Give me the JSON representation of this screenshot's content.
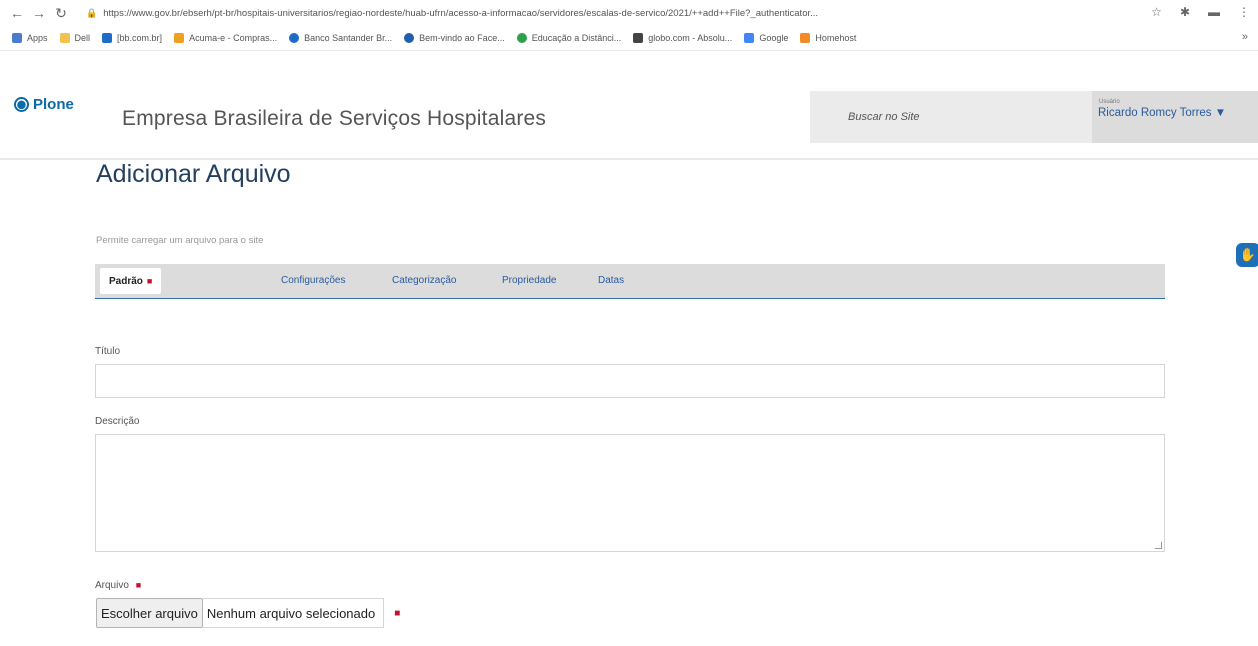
{
  "browser": {
    "url": "https://www.gov.br/ebserh/pt-br/hospitais-universitarios/regiao-nordeste/huab-ufrn/acesso-a-informacao/servidores/escalas-de-servico/2021/++add++File?_authenticator...",
    "bookmarks": [
      {
        "label": "Apps",
        "icon": "apps-grid-icon",
        "color": "#4a7bd0"
      },
      {
        "label": "Dell",
        "icon": "folder-icon",
        "color": "#f2c14e"
      },
      {
        "label": "[bb.com.br]",
        "icon": "bb-icon",
        "color": "#1e6cc8"
      },
      {
        "label": "Acuma-e - Compras...",
        "icon": "store-icon",
        "color": "#f0a020"
      },
      {
        "label": "Banco Santander Br...",
        "icon": "santander-icon",
        "color": "#1e6cc8"
      },
      {
        "label": "Bem-vindo ao Face...",
        "icon": "facebook-icon",
        "color": "#1f5fb0"
      },
      {
        "label": "Educação a Distânci...",
        "icon": "education-icon",
        "color": "#2ea04a"
      },
      {
        "label": "globo.com - Absolu...",
        "icon": "globo-icon",
        "color": "#444444"
      },
      {
        "label": "Google",
        "icon": "google-icon",
        "color": "#4285f4"
      },
      {
        "label": "Homehost",
        "icon": "homehost-icon",
        "color": "#f28c28"
      }
    ]
  },
  "header": {
    "logo_text": "Plone",
    "site_title": "Empresa Brasileira de Serviços Hospitalares",
    "search_placeholder": "Buscar no Site",
    "user_label": "Usuário",
    "user_name": "Ricardo Romcy Torres ▼"
  },
  "page": {
    "title": "Adicionar Arquivo",
    "description": "Permite carregar um arquivo para o site",
    "tabs": [
      {
        "label": "Padrão",
        "active": true
      },
      {
        "label": "Configurações"
      },
      {
        "label": "Categorização"
      },
      {
        "label": "Propriedade"
      },
      {
        "label": "Datas"
      }
    ],
    "required_mark": "■",
    "fields": {
      "title_label": "Título",
      "title_value": "",
      "description_label": "Descrição",
      "description_value": "",
      "file_label": "Arquivo",
      "file_button": "Escolher arquivo",
      "file_status": "Nenhum arquivo selecionado"
    }
  },
  "colors": {
    "accent": "#2a5b9c",
    "plone_blue": "#0b6aa8",
    "required_red": "#c8102e",
    "tab_bar": "#dcdcdc"
  }
}
